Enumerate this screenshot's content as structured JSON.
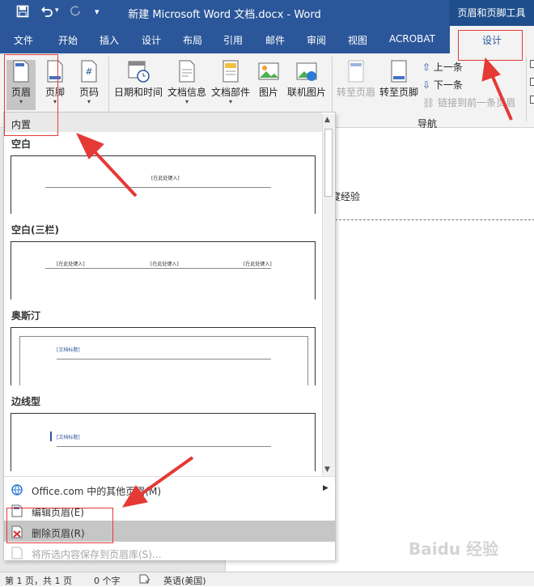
{
  "title_bar": {
    "title": "新建 Microsoft Word 文档.docx - Word",
    "context_tool": "页眉和页脚工具"
  },
  "tabs": [
    "文件",
    "开始",
    "插入",
    "设计",
    "布局",
    "引用",
    "邮件",
    "审阅",
    "视图",
    "ACROBAT"
  ],
  "context_tab": "设计",
  "ribbon": {
    "header": "页眉",
    "footer": "页脚",
    "page_number": "页码",
    "datetime": "日期和时间",
    "doc_info": "文档信息",
    "doc_parts": "文档部件",
    "picture": "图片",
    "online_picture": "联机图片",
    "goto_header": "转至页眉",
    "goto_footer": "转至页脚",
    "prev": "上一条",
    "next": "下一条",
    "link_prev": "链接到前一条页眉",
    "group_nav": "导航"
  },
  "gallery": {
    "section": "内置",
    "items": [
      {
        "name": "空白",
        "placeholders": [
          "[在此处键入]"
        ]
      },
      {
        "name": "空白(三栏)",
        "placeholders": [
          "[在此处键入]",
          "[在此处键入]",
          "[在此处键入]"
        ]
      },
      {
        "name": "奥斯汀",
        "placeholders": [
          "[文档标题]"
        ]
      },
      {
        "name": "边线型",
        "placeholders": [
          "[文档标题]"
        ]
      }
    ]
  },
  "menu": {
    "more": "Office.com 中的其他页眉(M)",
    "edit": "编辑页眉(E)",
    "remove": "删除页眉(R)",
    "save": "将所选内容保存到页眉库(S)..."
  },
  "document": {
    "text": "度经验"
  },
  "status": {
    "page": "第 1 页，共 1 页",
    "words": "0 个字",
    "lang": "英语(美国)"
  },
  "watermark": "Baidu 经验"
}
